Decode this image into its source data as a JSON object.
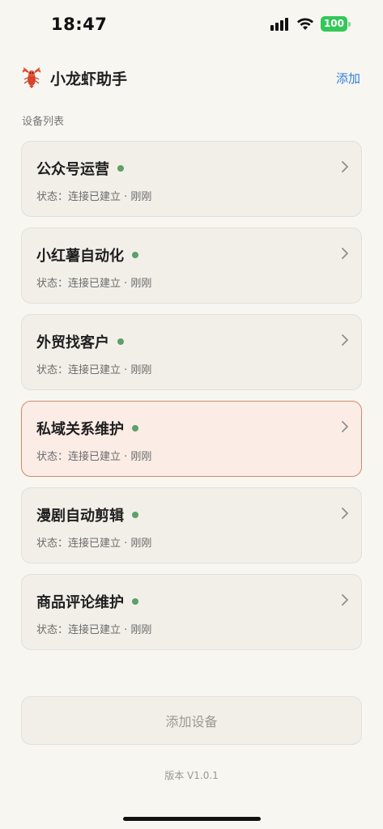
{
  "status_bar": {
    "time": "18:47",
    "battery": "100"
  },
  "header": {
    "title": "小龙虾助手",
    "add_label": "添加",
    "logo_icon": "lobster-icon"
  },
  "section_label": "设备列表",
  "devices": [
    {
      "name": "公众号运营",
      "status": "状态：连接已建立 · 刚刚"
    },
    {
      "name": "小红薯自动化",
      "status": "状态：连接已建立 · 刚刚"
    },
    {
      "name": "外贸找客户",
      "status": "状态：连接已建立 · 刚刚"
    },
    {
      "name": "私域关系维护",
      "status": "状态：连接已建立 · 刚刚"
    },
    {
      "name": "漫剧自动剪辑",
      "status": "状态：连接已建立 · 刚刚"
    },
    {
      "name": "商品评论维护",
      "status": "状态：连接已建立 · 刚刚"
    }
  ],
  "add_device_label": "添加设备",
  "version": "版本 V1.0.1",
  "colors": {
    "accent": "#2d7fe0",
    "online": "#5e9f6a",
    "selected_border": "#d08a68",
    "battery": "#34c759"
  }
}
